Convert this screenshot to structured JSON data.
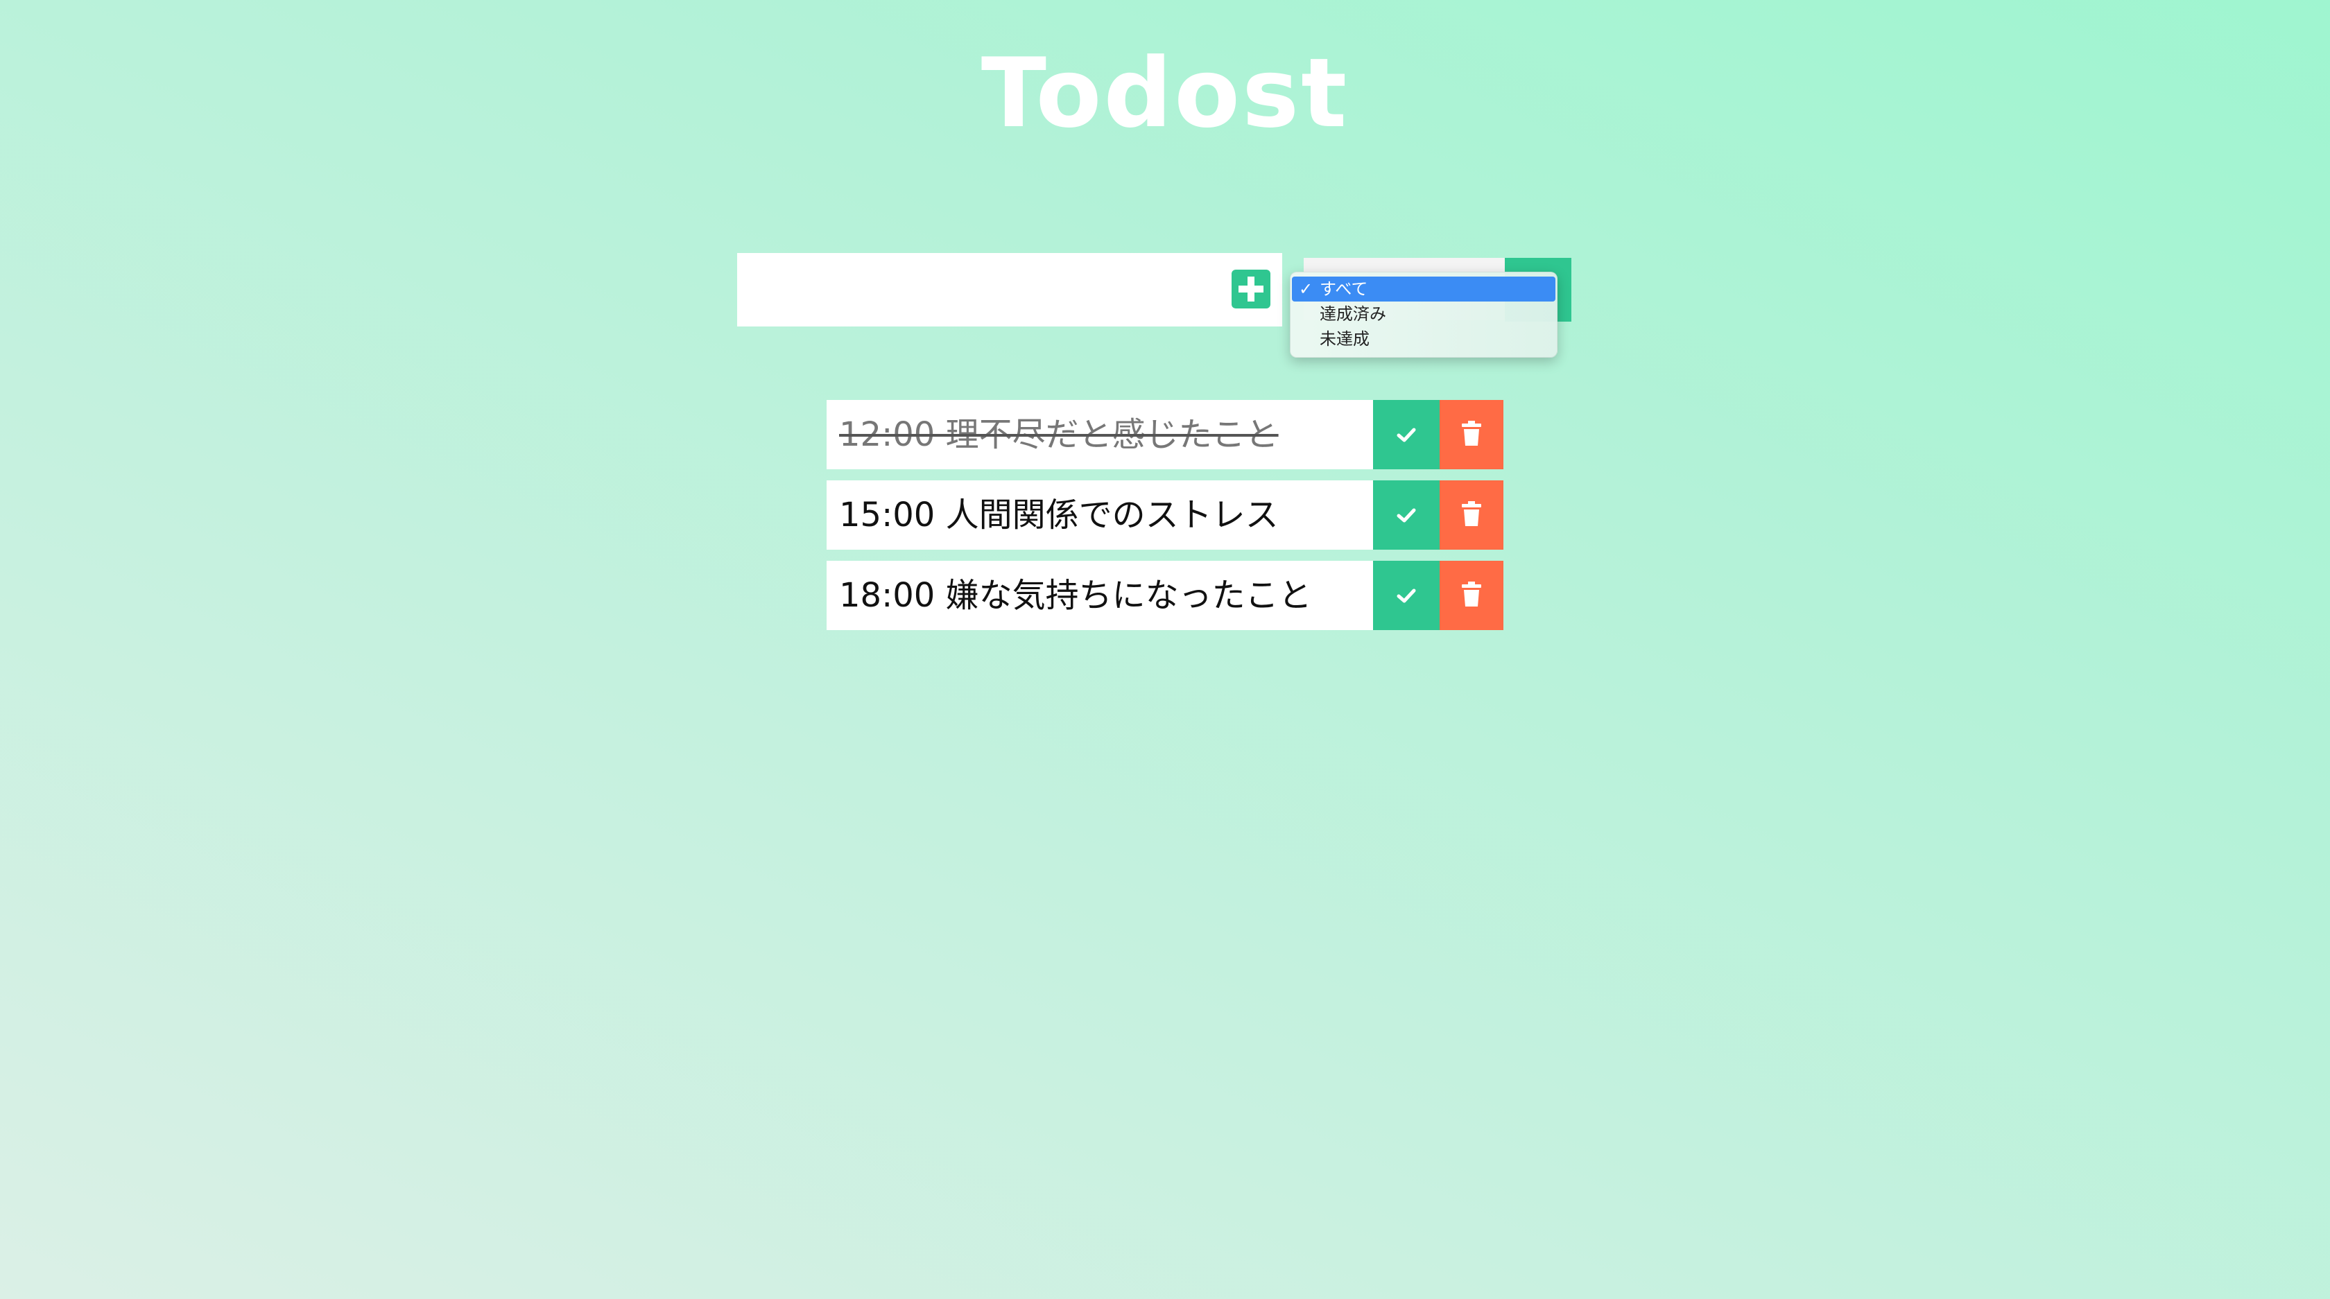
{
  "app": {
    "title": "Todost"
  },
  "add_form": {
    "input_value": "",
    "add_icon": "plus-icon"
  },
  "filter": {
    "options": [
      {
        "label": "すべて",
        "selected": true
      },
      {
        "label": "達成済み",
        "selected": false
      },
      {
        "label": "未達成",
        "selected": false
      }
    ],
    "check_mark": "✓",
    "selected_color": "#3b8cf4"
  },
  "todos": [
    {
      "text": "12:00 理不尽だと感じたこと",
      "completed": true
    },
    {
      "text": "15:00 人間関係でのストレス",
      "completed": false
    },
    {
      "text": "18:00 嫌な気持ちになったこと",
      "completed": false
    }
  ],
  "colors": {
    "accent_green": "#2fc690",
    "delete_orange": "#ff6b45",
    "title_color": "#ffffff"
  },
  "icons": {
    "complete": "check-icon",
    "delete": "trash-icon"
  }
}
